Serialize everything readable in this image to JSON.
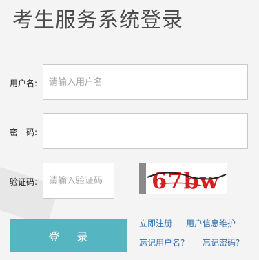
{
  "page": {
    "title": "考生服务系统登录"
  },
  "form": {
    "username_label": "用户名:",
    "username_placeholder": "请输入用户名",
    "username_value": "",
    "password_label": "密　码:",
    "password_value": "",
    "captcha_label": "验证码:",
    "captcha_placeholder": "请输入验证码",
    "captcha_value": "",
    "captcha_image_text": "67bw"
  },
  "actions": {
    "login_label": "登 录"
  },
  "links": {
    "register": "立即注册",
    "user_info": "用户信息维护",
    "forgot_username": "忘记用户名?",
    "forgot_password": "忘记密码?"
  },
  "colors": {
    "button": "#55b6c2",
    "link": "#2f6fb3",
    "captcha_text": "#d81f1f"
  }
}
